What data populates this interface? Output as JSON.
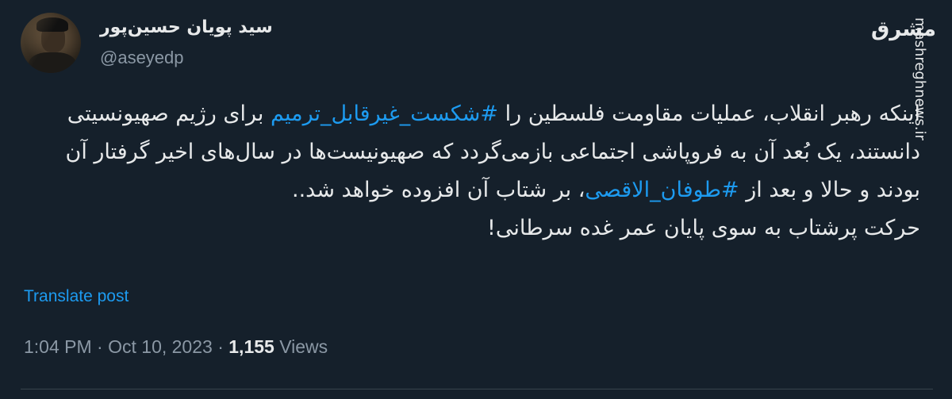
{
  "tweet": {
    "author": {
      "display_name": "سید پویان حسین‌پور",
      "handle": "@aseyedp"
    },
    "text": {
      "line1_part1": "اینکه رهبر انقلاب، عملیات مقاومت فلسطین را ",
      "hashtag1": "#شکست_غیرقابل_ترمیم",
      "line1_part2": " برای رژیم صهیونسیتی دانستند، یک بُعد آن به فروپاشی اجتماعی بازمی‌گردد که صهیونیست‌ها در سال‌های اخیر گرفتار آن بودند و حالا و بعد از ",
      "hashtag2": "#طوفان_الاقصی",
      "line1_part3": "، بر شتاب آن افزوده خواهد شد..",
      "line2": "حرکت پرشتاب به سوی پایان عمر غده سرطانی!"
    },
    "translate_label": "Translate post",
    "meta": {
      "time": "1:04 PM",
      "separator": "·",
      "date": "Oct 10, 2023",
      "views_count": "1,155",
      "views_label": "Views"
    }
  },
  "watermark": {
    "logo_text": "مشرق",
    "url": "mashreghnews.ir"
  },
  "colors": {
    "background": "#15202b",
    "text_primary": "#e7e9ea",
    "text_secondary": "#8b98a5",
    "accent": "#1d9bf0"
  }
}
